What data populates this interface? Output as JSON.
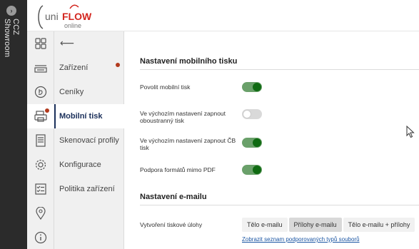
{
  "strip": {
    "label": "CCZ Showroom"
  },
  "logo": {
    "uni": "uni",
    "flow": "FLOW",
    "online": "online"
  },
  "nav": {
    "back_glyph": "⟵",
    "items": [
      {
        "label": "Zařízení",
        "badge": true
      },
      {
        "label": "Ceníky",
        "badge": false
      },
      {
        "label": "Mobilní tisk",
        "badge": true,
        "active": true
      },
      {
        "label": "Skenovací profily",
        "badge": false
      },
      {
        "label": "Konfigurace",
        "badge": false
      },
      {
        "label": "Politika zařízení",
        "badge": false
      }
    ]
  },
  "rail": {
    "icons": [
      "grid-icon",
      "printer-icon",
      "pricing-icon",
      "mobile-print-icon",
      "scan-icon",
      "settings-gear-icon",
      "policy-checklist-icon",
      "location-pin-icon",
      "info-icon"
    ]
  },
  "content": {
    "mobile_section_title": "Nastavení mobilního tisku",
    "email_section_title": "Nastavení e-mailu",
    "settings": [
      {
        "label": "Povolit mobilní tisk",
        "value": true
      },
      {
        "label": "Ve výchozím nastavení zapnout oboustranný tisk",
        "value": false
      },
      {
        "label": "Ve výchozím nastavení zapnout ČB tisk",
        "value": true
      },
      {
        "label": "Podpora formátů mimo PDF",
        "value": true
      }
    ],
    "print_job_label": "Vytvoření tiskové úlohy",
    "print_job_options": [
      "Tělo e-mailu",
      "Přílohy e-mailu",
      "Tělo e-mailu + přílohy"
    ],
    "print_job_selected": "Přílohy e-mailu",
    "supported_types_link": "Zobrazit seznam podporovaných typů souborů"
  },
  "colors": {
    "accent": "#1a2f5a",
    "toggle_on": "#0f6a12",
    "badge": "#b23a1d",
    "logo_red": "#d3261f"
  }
}
